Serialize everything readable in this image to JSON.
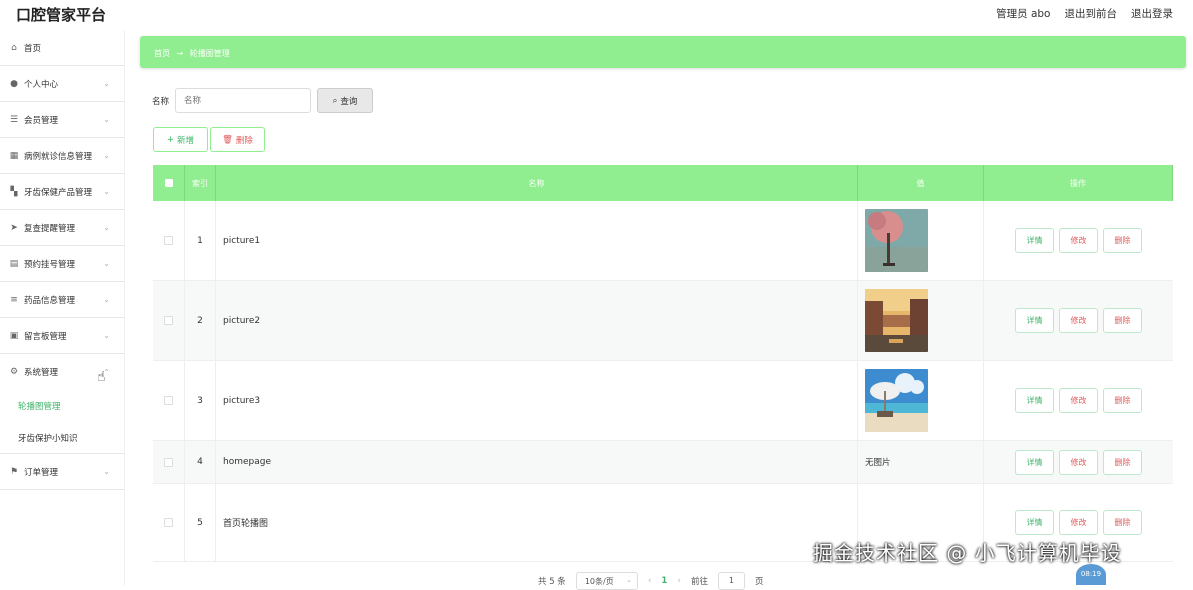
{
  "header": {
    "title": "口腔管家平台",
    "admin_label": "管理员 abo",
    "front_link": "退出到前台",
    "logout_link": "退出登录"
  },
  "sidebar": {
    "items": [
      {
        "label": "首页",
        "icon": "home-icon"
      },
      {
        "label": "个人中心",
        "icon": "user-icon"
      },
      {
        "label": "会员管理",
        "icon": "list-icon"
      },
      {
        "label": "病例就诊信息管理",
        "icon": "grid-icon"
      },
      {
        "label": "牙齿保健产品管理",
        "icon": "apps-icon"
      },
      {
        "label": "复查提醒管理",
        "icon": "send-icon"
      },
      {
        "label": "预约挂号管理",
        "icon": "bank-icon"
      },
      {
        "label": "药品信息管理",
        "icon": "menu-icon"
      },
      {
        "label": "留言板管理",
        "icon": "message-icon"
      },
      {
        "label": "系统管理",
        "icon": "settings-icon"
      }
    ],
    "subitems": [
      {
        "label": "轮播图管理",
        "active": true
      },
      {
        "label": "牙齿保护小知识",
        "active": false
      }
    ],
    "last_item": {
      "label": "订单管理",
      "icon": "flag-icon"
    }
  },
  "breadcrumb": {
    "home": "首页",
    "arrow": "→",
    "current": "轮播图管理"
  },
  "search": {
    "label": "名称",
    "placeholder": "名称",
    "button": "查询"
  },
  "actions": {
    "add": "新增",
    "delete": "删除"
  },
  "table": {
    "headers": {
      "index": "索引",
      "name": "名称",
      "value": "值",
      "ops": "操作"
    },
    "rows": [
      {
        "index": "1",
        "name": "picture1",
        "image": "tree"
      },
      {
        "index": "2",
        "name": "picture2",
        "image": "canal"
      },
      {
        "index": "3",
        "name": "picture3",
        "image": "beach"
      },
      {
        "index": "4",
        "name": "homepage",
        "noimage": "无图片"
      },
      {
        "index": "5",
        "name": "首页轮播图",
        "noimage": ""
      }
    ],
    "op_labels": {
      "detail": "详情",
      "edit": "修改",
      "delete": "删除"
    }
  },
  "pagination": {
    "total": "共 5 条",
    "page_size": "10条/页",
    "current": "1",
    "goto_label": "前往",
    "goto_value": "1",
    "page_unit": "页"
  },
  "overlay": {
    "watermark": "掘金技术社区 @ 小飞计算机毕设",
    "timer": "08:19"
  },
  "colors": {
    "accent": "#90ee90",
    "accent_text": "#3fb36a",
    "danger": "#e05a5a"
  }
}
